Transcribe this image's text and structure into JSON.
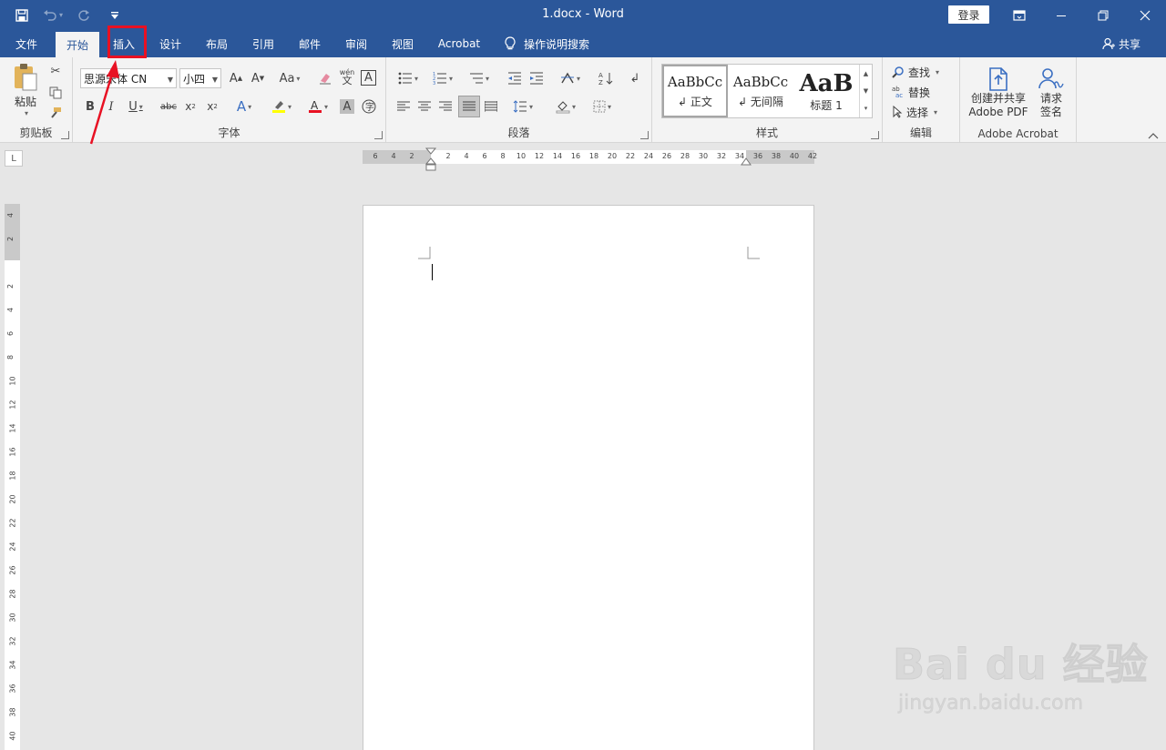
{
  "window": {
    "title": "1.docx  -  Word",
    "login_label": "登录",
    "colors": {
      "brand": "#2b579a",
      "highlight": "#e81123"
    }
  },
  "qat": {
    "icons": [
      "save-icon",
      "undo-icon",
      "redo-icon",
      "customize-qat-icon"
    ]
  },
  "tabs": [
    {
      "label": "文件"
    },
    {
      "label": "开始",
      "active": true
    },
    {
      "label": "插入",
      "highlighted": true
    },
    {
      "label": "设计"
    },
    {
      "label": "布局"
    },
    {
      "label": "引用"
    },
    {
      "label": "邮件"
    },
    {
      "label": "审阅"
    },
    {
      "label": "视图"
    },
    {
      "label": "Acrobat"
    }
  ],
  "tellme": {
    "label": "操作说明搜索"
  },
  "share": {
    "label": "共享"
  },
  "clipboard": {
    "paste_label": "粘贴",
    "group_label": "剪贴板"
  },
  "font": {
    "name": "思源宋体 CN",
    "size": "小四",
    "group_label": "字体",
    "case_label": "Aa",
    "phonetic_top": "wén",
    "phonetic_bottom": "文",
    "border_char": "A"
  },
  "paragraph": {
    "group_label": "段落"
  },
  "styles": {
    "group_label": "样式",
    "items": [
      {
        "sample": "AaBbCc",
        "name": "正文",
        "selected": true
      },
      {
        "sample": "AaBbCc",
        "name": "无间隔"
      },
      {
        "sample": "AaB",
        "name": "标题 1"
      }
    ]
  },
  "editing": {
    "find_label": "查找",
    "replace_label": "替换",
    "select_label": "选择",
    "group_label": "编辑"
  },
  "acrobat": {
    "create_label_1": "创建并共享",
    "create_label_2": "Adobe PDF",
    "sign_label_1": "请求",
    "sign_label_2": "签名",
    "group_label": "Adobe Acrobat"
  },
  "ruler": {
    "corner": "L",
    "h_ticks": [
      "6",
      "4",
      "2",
      "2",
      "4",
      "6",
      "8",
      "10",
      "12",
      "14",
      "16",
      "18",
      "20",
      "22",
      "24",
      "26",
      "28",
      "30",
      "32",
      "34",
      "36",
      "38",
      "40",
      "42"
    ],
    "v_ticks": [
      "4",
      "2",
      "2",
      "4",
      "6",
      "8",
      "10",
      "12",
      "14",
      "16",
      "18",
      "20",
      "22",
      "24",
      "26",
      "28",
      "30",
      "32",
      "34",
      "36",
      "38",
      "40"
    ]
  },
  "watermark": {
    "main": "Bai du 经验",
    "sub": "jingyan.baidu.com"
  }
}
